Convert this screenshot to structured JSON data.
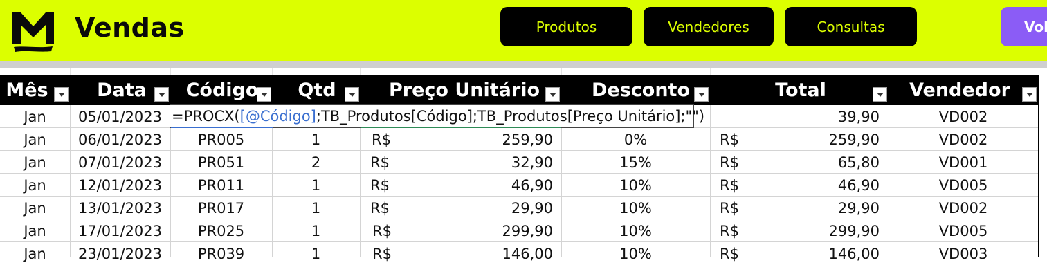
{
  "app": {
    "title": "Vendas",
    "logo_icon": "m-logo-icon",
    "accent_color": "#dcff00",
    "button_color": "#000000",
    "back_button_color": "#8b5cf6"
  },
  "nav": {
    "produtos": "Produtos",
    "vendedores": "Vendedores",
    "consultas": "Consultas",
    "voltar": "Vol"
  },
  "table": {
    "headers": [
      "Mês",
      "Data",
      "Código",
      "Qtd",
      "Preço Unitário",
      "Desconto",
      "Total",
      "Vendedor"
    ],
    "currency": "R$",
    "formula": {
      "prefix": "=PROCX(",
      "ref": "[@Código]",
      "rest": ";TB_Produtos[Código];TB_Produtos[Preço Unitário];\"\")"
    },
    "rows": [
      {
        "mes": "Jan",
        "data": "05/01/2023",
        "codigo": "",
        "qtd": "",
        "preco": "",
        "desconto": "",
        "total": "39,90",
        "vendedor": "VD002"
      },
      {
        "mes": "Jan",
        "data": "06/01/2023",
        "codigo": "PR005",
        "qtd": "1",
        "preco": "259,90",
        "desconto": "0%",
        "total": "259,90",
        "vendedor": "VD002"
      },
      {
        "mes": "Jan",
        "data": "07/01/2023",
        "codigo": "PR051",
        "qtd": "2",
        "preco": "32,90",
        "desconto": "15%",
        "total": "65,80",
        "vendedor": "VD001"
      },
      {
        "mes": "Jan",
        "data": "12/01/2023",
        "codigo": "PR011",
        "qtd": "1",
        "preco": "46,90",
        "desconto": "10%",
        "total": "46,90",
        "vendedor": "VD005"
      },
      {
        "mes": "Jan",
        "data": "13/01/2023",
        "codigo": "PR017",
        "qtd": "1",
        "preco": "29,90",
        "desconto": "10%",
        "total": "29,90",
        "vendedor": "VD002"
      },
      {
        "mes": "Jan",
        "data": "17/01/2023",
        "codigo": "PR025",
        "qtd": "1",
        "preco": "299,90",
        "desconto": "10%",
        "total": "299,90",
        "vendedor": "VD005"
      },
      {
        "mes": "Jan",
        "data": "23/01/2023",
        "codigo": "PR039",
        "qtd": "1",
        "preco": "146,00",
        "desconto": "10%",
        "total": "146,00",
        "vendedor": "VD003"
      }
    ]
  }
}
